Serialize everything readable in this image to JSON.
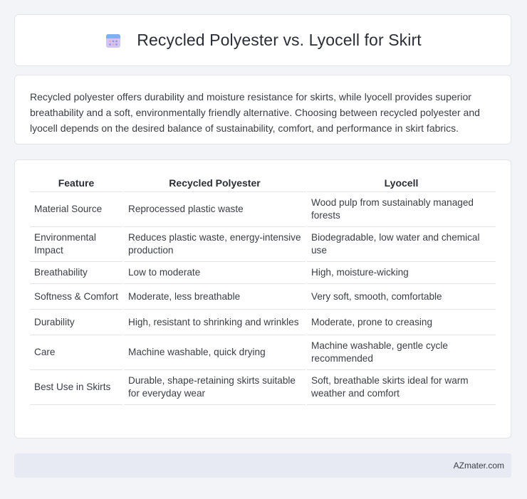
{
  "header": {
    "title": "Recycled Polyester vs. Lyocell for Skirt",
    "icon": "calendar-icon"
  },
  "summary": {
    "text": "Recycled polyester offers durability and moisture resistance for skirts, while lyocell provides superior breathability and a soft, environmentally friendly alternative. Choosing between recycled polyester and lyocell depends on the desired balance of sustainability, comfort, and performance in skirt fabrics."
  },
  "table": {
    "headers": [
      "Feature",
      "Recycled Polyester",
      "Lyocell"
    ],
    "rows": [
      [
        "Material Source",
        "Reprocessed plastic waste",
        "Wood pulp from sustainably managed forests"
      ],
      [
        "Environmental Impact",
        "Reduces plastic waste, energy-intensive production",
        "Biodegradable, low water and chemical use"
      ],
      [
        "Breathability",
        "Low to moderate",
        "High, moisture-wicking"
      ],
      [
        "Softness & Comfort",
        "Moderate, less breathable",
        "Very soft, smooth, comfortable"
      ],
      [
        "Durability",
        "High, resistant to shrinking and wrinkles",
        "Moderate, prone to creasing"
      ],
      [
        "Care",
        "Machine washable, quick drying",
        "Machine washable, gentle cycle recommended"
      ],
      [
        "Best Use in Skirts",
        "Durable, shape-retaining skirts suitable for everyday wear",
        "Soft, breathable skirts ideal for warm weather and comfort"
      ]
    ]
  },
  "footer": {
    "brand": "AZmater.com"
  }
}
